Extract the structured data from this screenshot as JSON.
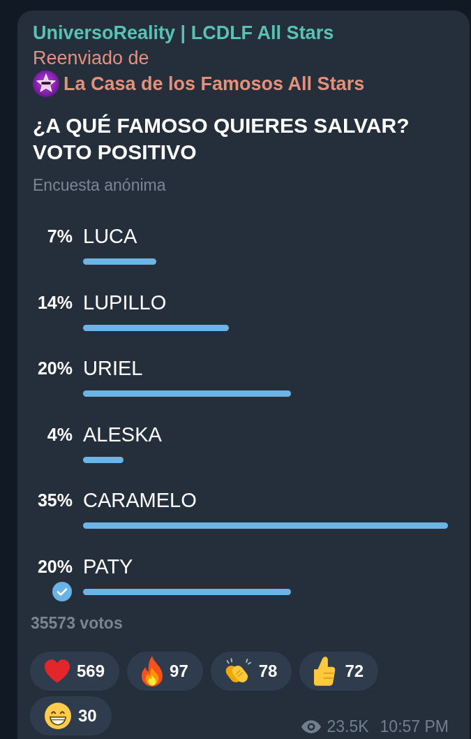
{
  "message": {
    "channel": "UniversoReality | LCDLF All Stars",
    "forwarded_label": "Reenviado de",
    "forwarded_from": "La Casa de los Famosos All Stars"
  },
  "poll": {
    "question": "¿A QUÉ FAMOSO QUIERES SALVAR? VOTO POSITIVO",
    "type_label": "Encuesta anónima",
    "options": [
      {
        "percent": "7%",
        "label": "LUCA",
        "level": 0.2,
        "selected": false
      },
      {
        "percent": "14%",
        "label": "LUPILLO",
        "level": 0.4,
        "selected": false
      },
      {
        "percent": "20%",
        "label": "URIEL",
        "level": 0.57,
        "selected": false
      },
      {
        "percent": "4%",
        "label": "ALESKA",
        "level": 0.11,
        "selected": false
      },
      {
        "percent": "35%",
        "label": "CARAMELO",
        "level": 1,
        "selected": false
      },
      {
        "percent": "20%",
        "label": "PATY",
        "level": 0.57,
        "selected": true
      }
    ],
    "total_votes": "35573 votos"
  },
  "reactions": [
    {
      "kind": "heart",
      "count": "569"
    },
    {
      "kind": "fire",
      "count": "97"
    },
    {
      "kind": "clap",
      "count": "78"
    },
    {
      "kind": "thumbs_up",
      "count": "72"
    },
    {
      "kind": "grin",
      "count": "30"
    }
  ],
  "footer": {
    "views": "23.5K",
    "time": "10:57 PM"
  }
}
